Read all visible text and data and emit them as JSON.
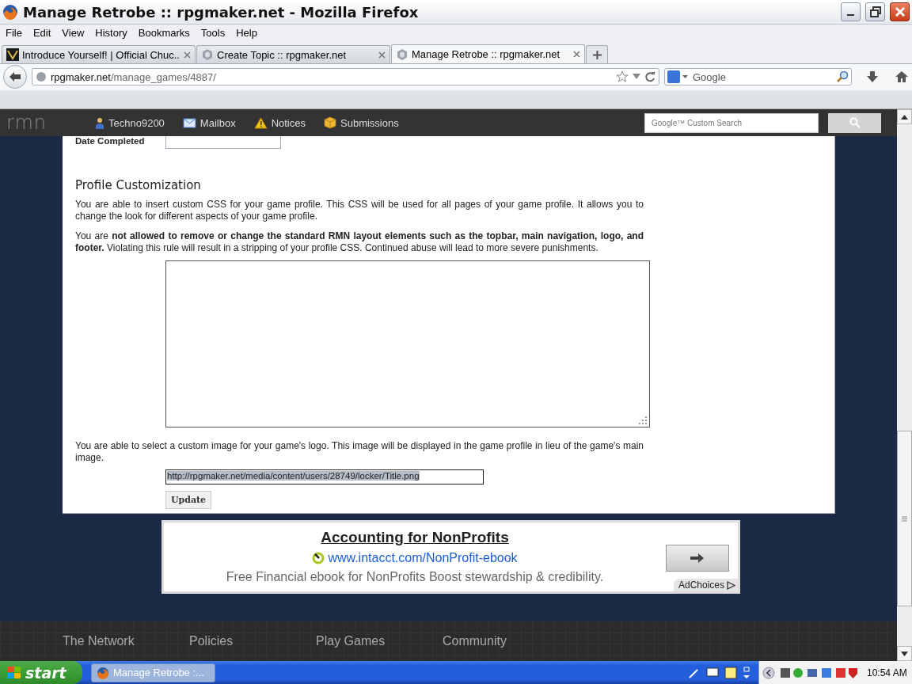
{
  "window": {
    "title": "Manage Retrobe :: rpgmaker.net - Mozilla Firefox"
  },
  "menu": [
    "File",
    "Edit",
    "View",
    "History",
    "Bookmarks",
    "Tools",
    "Help"
  ],
  "tabs": [
    {
      "label": "Introduce Yourself! | Official Chuc...",
      "selected": false,
      "kind": "game"
    },
    {
      "label": "Create Topic :: rpgmaker.net",
      "selected": false,
      "kind": "site"
    },
    {
      "label": "Manage Retrobe :: rpgmaker.net",
      "selected": true,
      "kind": "site"
    }
  ],
  "address": {
    "host": "rpgmaker.net",
    "path": "/manage_games/4887/"
  },
  "browser_search": {
    "placeholder": "Google"
  },
  "site_topbar": {
    "logo": "rmn",
    "items": [
      {
        "label": "Techno9200",
        "kind": "user"
      },
      {
        "label": "Mailbox",
        "kind": "mail"
      },
      {
        "label": "Notices",
        "kind": "warning"
      },
      {
        "label": "Submissions",
        "kind": "box"
      }
    ],
    "search_placeholder": "Google™ Custom Search"
  },
  "form": {
    "date_label": "Date Completed",
    "section_title": "Profile Customization",
    "intro": "You are able to insert custom CSS for your game profile. This CSS will be used for all pages of your game profile. It allows you to change the look for different aspects of your game profile.",
    "rule": "You are **not allowed to remove or change the standard RMN layout elements such as the topbar, main navigation, logo, and footer.** Violating this rule will result in a stripping of your profile CSS. Continued abuse will lead to more severe punishments.",
    "logo_text": "You are able to select a custom image for your game's logo. This image will be displayed in the game profile in lieu of the game's main image.",
    "logo_url": "http://rpgmaker.net/media/content/users/28749/locker/Title.png",
    "button": "Update"
  },
  "ad": {
    "title": "Accounting for NonProfits",
    "url": "www.intacct.com/NonProfit-ebook",
    "description": "Free Financial ebook for NonProfits Boost stewardship & credibility.",
    "adchoices": "AdChoices"
  },
  "footer": {
    "headings": [
      "The Network",
      "Policies",
      "Play Games",
      "Community"
    ]
  },
  "taskbar": {
    "start": "start",
    "task": "Manage Retrobe :...",
    "clock": "10:54 AM"
  }
}
